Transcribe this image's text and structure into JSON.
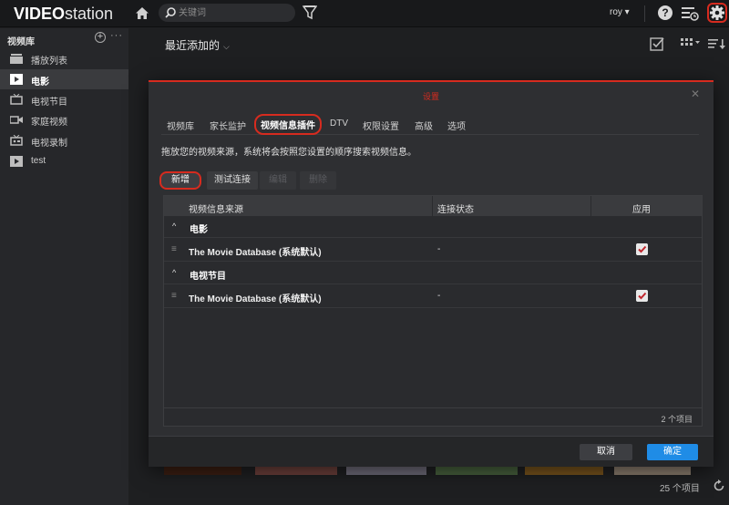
{
  "app": {
    "logo_bold": "VIDEO",
    "logo_light": "station"
  },
  "topbar": {
    "search_placeholder": "关键词",
    "user": "roy ▾"
  },
  "sidebar": {
    "header": "视频库",
    "add": "+",
    "more": "···",
    "items": [
      {
        "label": "播放列表",
        "icon": "playlist-icon"
      },
      {
        "label": "电影",
        "icon": "movie-icon",
        "active": true
      },
      {
        "label": "电视节目",
        "icon": "tv-icon"
      },
      {
        "label": "家庭视频",
        "icon": "camera-icon"
      },
      {
        "label": "电视录制",
        "icon": "recording-icon"
      },
      {
        "label": "test",
        "icon": "video-library-icon"
      }
    ]
  },
  "main": {
    "title": "最近添加的",
    "title_chevron": "⌵",
    "footer_count": "25 个项目"
  },
  "modal": {
    "title": "设置",
    "close": "✕",
    "tabs": [
      "视频库",
      "家长监护",
      "视频信息插件",
      "DTV",
      "权限设置",
      "高级",
      "选项"
    ],
    "active_tab": "视频信息插件",
    "description": "拖放您的视频来源，系统将会按照您设置的顺序搜索视频信息。",
    "buttons": {
      "new": "新增",
      "test": "测试连接",
      "edit": "编辑",
      "delete": "删除"
    },
    "grid": {
      "columns": [
        "视频信息来源",
        "连接状态",
        "应用"
      ],
      "groups": [
        {
          "label": "电影",
          "chevron": "^",
          "rows": [
            {
              "drag": "≡",
              "source": "The Movie Database (系统默认)",
              "status": "-",
              "applied": true
            }
          ]
        },
        {
          "label": "电视节目",
          "chevron": "^",
          "rows": [
            {
              "drag": "≡",
              "source": "The Movie Database (系统默认)",
              "status": "-",
              "applied": true
            }
          ]
        }
      ],
      "count": "2 个项目"
    },
    "footer": {
      "cancel": "取消",
      "ok": "确定"
    }
  },
  "colors": {
    "accent_red": "#d62b1f",
    "primary_blue": "#1f8ce6",
    "checkmark": "#c0262d"
  }
}
